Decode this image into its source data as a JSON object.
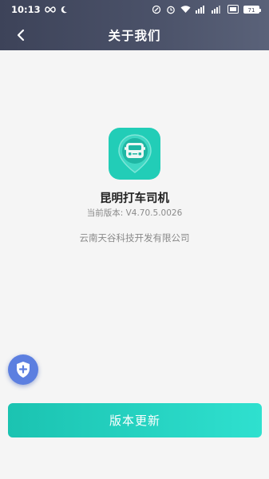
{
  "status_bar": {
    "time": "10:13",
    "battery": "71"
  },
  "nav": {
    "title": "关于我们"
  },
  "app": {
    "name": "昆明打车司机",
    "version": "当前版本: V4.70.5.0026",
    "company": "云南天谷科技开发有限公司"
  },
  "actions": {
    "update_label": "版本更新"
  },
  "colors": {
    "header": "#434a60",
    "accent": "#22cdb7",
    "fab": "#5c7fe0"
  },
  "icons": {
    "back": "back-arrow-icon",
    "fab": "shield-plus-icon",
    "logo": "car-in-pin-logo"
  }
}
